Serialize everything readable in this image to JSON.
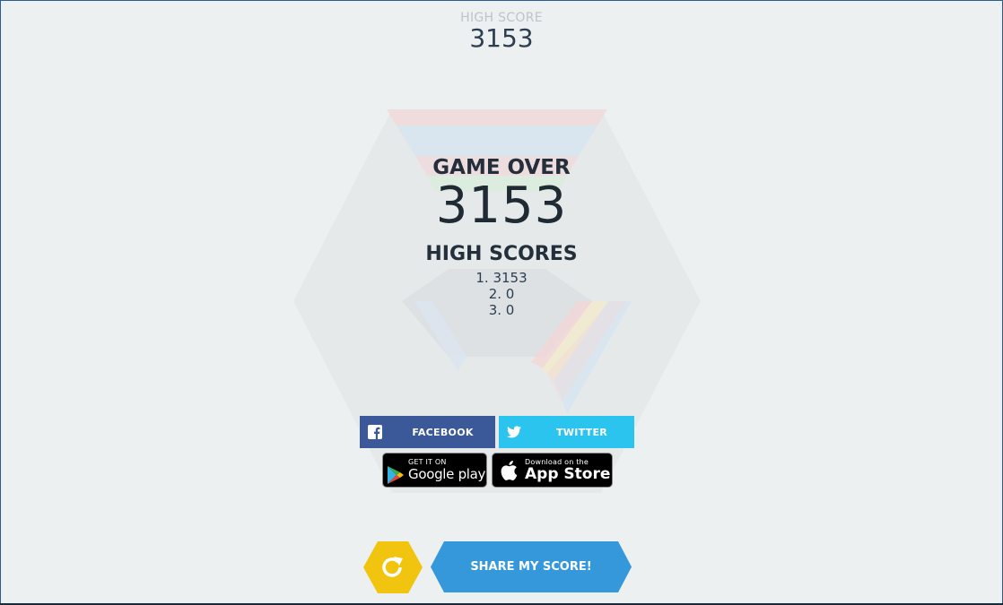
{
  "header": {
    "high_score_label": "HIGH SCORE",
    "high_score_value": "3153"
  },
  "game_over": {
    "title": "GAME OVER",
    "score": "3153"
  },
  "high_scores": {
    "title": "HIGH SCORES",
    "entries": [
      "1. 3153",
      "2. 0",
      "3. 0"
    ]
  },
  "social": {
    "facebook_label": "FACEBOOK",
    "twitter_label": "TWITTER"
  },
  "stores": {
    "google_small": "GET IT ON",
    "google_big": "Google play",
    "apple_small": "Download on the",
    "apple_big": "App Store"
  },
  "actions": {
    "share_label": "SHARE MY SCORE!",
    "restart_icon": "refresh-icon"
  },
  "colors": {
    "background": "#ecf0f1",
    "facebook": "#3b5998",
    "twitter": "#2bc4ef",
    "restart": "#f1c40f",
    "share": "#3498db",
    "text_dark": "#232f3a"
  }
}
